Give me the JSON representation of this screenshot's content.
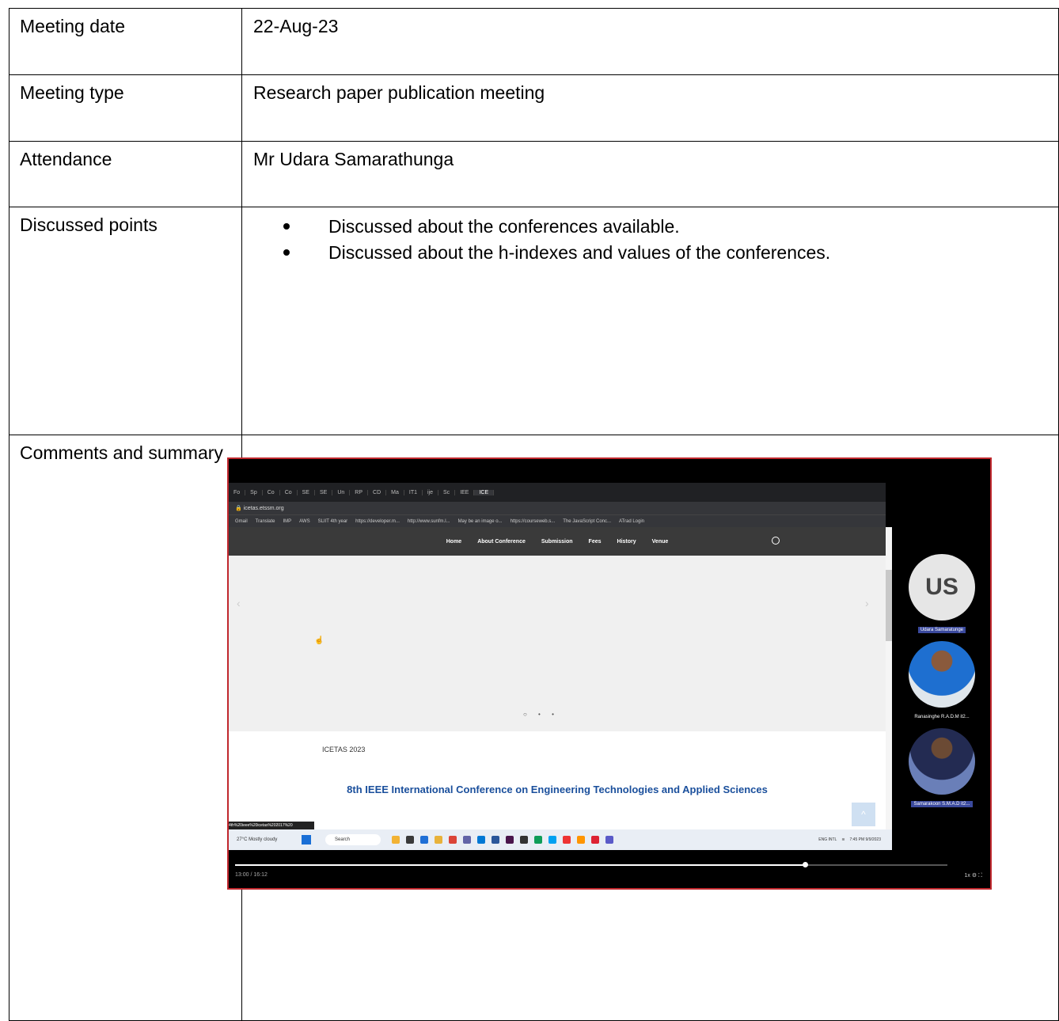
{
  "rows": [
    {
      "label": "Meeting date",
      "value": "22-Aug-23"
    },
    {
      "label": "Meeting type",
      "value": "Research paper publication meeting"
    },
    {
      "label": "Attendance",
      "value": "Mr Udara Samarathunga"
    }
  ],
  "discussed": {
    "label": "Discussed points",
    "points": [
      "Discussed about the conferences available.",
      "Discussed about the h-indexes and values of the conferences."
    ]
  },
  "comments": {
    "label": "Comments and summary"
  },
  "screenshot": {
    "address": "icetas.etssm.org",
    "nav": [
      "Home",
      "About Conference",
      "Submission",
      "Fees",
      "History",
      "Venue"
    ],
    "site_subtitle": "ICETAS 2023",
    "site_title": "8th IEEE International Conference on Engineering Technologies and Applied Sciences",
    "status_url": "4th%20ieee%20icetas%202017%20",
    "weather": "27°C Mostly cloudy",
    "taskbar_search": "Search",
    "clock": "7:45 PM 9/9/2023",
    "lang": "ENG INTL",
    "time_code": "13:00 / 16:12",
    "participants": [
      {
        "initials": "US",
        "name": "Udara Samaratunge"
      },
      {
        "name": "Ranasinghe R.A.D.M it2..."
      },
      {
        "name": "Samarakoon S.M.A.D it2..."
      }
    ],
    "progress": 0.8
  }
}
